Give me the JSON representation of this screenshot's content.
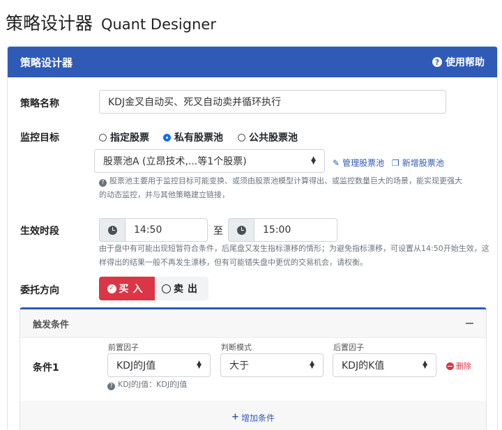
{
  "page": {
    "title": "策略设计器",
    "subtitle": "Quant Designer"
  },
  "card": {
    "header_title": "策略设计器",
    "help_label": "使用帮助"
  },
  "strategy": {
    "name_label": "策略名称",
    "name_value": "KDJ金叉自动买、死叉自动卖并循环执行"
  },
  "monitor": {
    "label": "监控目标",
    "options": [
      "指定股票",
      "私有股票池",
      "公共股票池"
    ],
    "selected_index": 1,
    "pool_select": "股票池A (立昂技术,...等1个股票)",
    "manage_link": "管理股票池",
    "new_link": "新增股票池",
    "hint_line1": "股票池主要用于监控目标可能变换、或须由股票池模型计算得出、或监控数量巨大的场景，能实现更强大",
    "hint_line2": "的动态监控，并与其他策略建立链接，"
  },
  "period": {
    "label": "生效时段",
    "start": "14:50",
    "separator": "至",
    "end": "15:00",
    "hint_line1": "由于盘中有可能出现短暂符合条件，后尾盘又发生指标漂移的情形；为避免指标漂移，可设置从14:50开始生效，这",
    "hint_line2": "样得出的结果一般不再发生漂移，但有可能错失盘中更优的交易机会，请权衡。"
  },
  "direction": {
    "label": "委托方向",
    "buy": "买入",
    "sell": "卖出",
    "selected": "buy"
  },
  "trigger": {
    "title": "触发条件",
    "condition_label": "条件1",
    "front_factor_label": "前置因子",
    "front_factor": "KDJ的J值",
    "mode_label": "判断模式",
    "mode": "大于",
    "back_factor_label": "后置因子",
    "back_factor": "KDJ的K值",
    "delete_label": "删除",
    "factor_hint": "KDJ的J值：KDJ的J值",
    "add_condition": "增加条件"
  },
  "colors": {
    "brand": "#2f5bb7",
    "danger": "#dc3545"
  },
  "icons": [
    "question-circle-icon",
    "clock-icon",
    "edit-icon",
    "copy-icon",
    "check-circle-icon",
    "circle-icon",
    "minus-icon",
    "minus-circle-icon",
    "plus-icon",
    "select-arrows-icon"
  ]
}
